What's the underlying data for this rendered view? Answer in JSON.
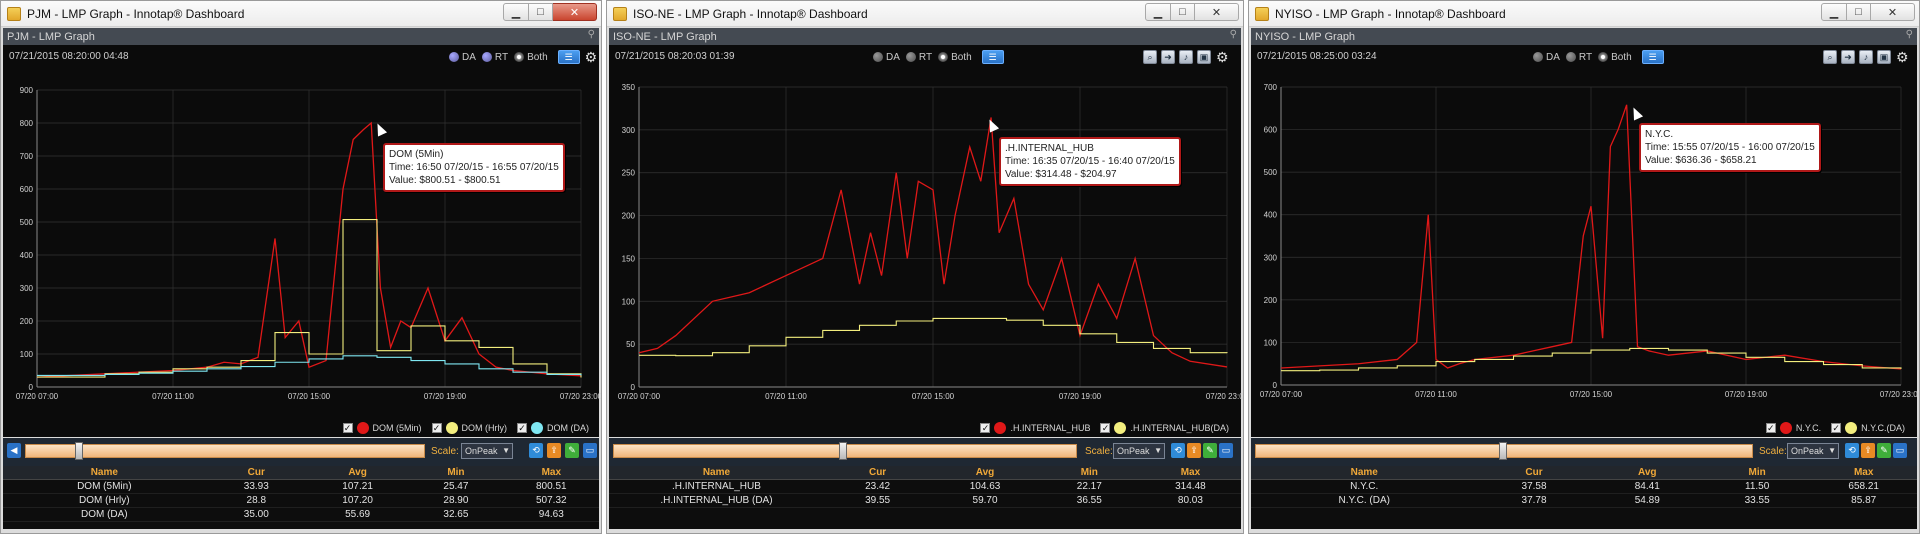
{
  "windows": [
    {
      "title": "PJM - LMP Graph - Innotap® Dashboard",
      "subtitle": "PJM - LMP Graph",
      "timestamp": "07/21/2015 08:20:00  04:48",
      "radio": {
        "da": "DA",
        "rt": "RT",
        "both": "Both",
        "selected": "Both"
      },
      "tooltip": {
        "title": "DOM (5Min)",
        "time": "Time: 16:50 07/20/15 - 16:55 07/20/15",
        "value": "Value: $800.51 - $800.51"
      },
      "scale_label": "Scale:",
      "scale_value": "OnPeak",
      "table": {
        "headers": [
          "Name",
          "Cur",
          "Avg",
          "Min",
          "Max"
        ],
        "rows": [
          [
            "DOM (5Min)",
            "33.93",
            "107.21",
            "25.47",
            "800.51"
          ],
          [
            "DOM (Hrly)",
            "28.8",
            "107.20",
            "28.90",
            "507.32"
          ],
          [
            "DOM (DA)",
            "35.00",
            "55.69",
            "32.65",
            "94.63"
          ]
        ]
      },
      "legend": [
        {
          "label": "DOM (5Min)",
          "color": "#e01818"
        },
        {
          "label": "DOM (Hrly)",
          "color": "#f3ee7e"
        },
        {
          "label": "DOM (DA)",
          "color": "#7fe7f2"
        }
      ]
    },
    {
      "title": "ISO-NE - LMP Graph - Innotap® Dashboard",
      "subtitle": "ISO-NE - LMP Graph",
      "timestamp": "07/21/2015 08:20:03  01:39",
      "radio": {
        "da": "DA",
        "rt": "RT",
        "both": "Both",
        "selected": "Both"
      },
      "tooltip": {
        "title": ".H.INTERNAL_HUB",
        "time": "Time: 16:35 07/20/15 - 16:40 07/20/15",
        "value": "Value: $314.48 - $204.97"
      },
      "scale_label": "Scale:",
      "scale_value": "OnPeak",
      "table": {
        "headers": [
          "Name",
          "Cur",
          "Avg",
          "Min",
          "Max"
        ],
        "rows": [
          [
            ".H.INTERNAL_HUB",
            "23.42",
            "104.63",
            "22.17",
            "314.48"
          ],
          [
            ".H.INTERNAL_HUB (DA)",
            "39.55",
            "59.70",
            "36.55",
            "80.03"
          ]
        ]
      },
      "legend": [
        {
          "label": ".H.INTERNAL_HUB",
          "color": "#e01818"
        },
        {
          "label": ".H.INTERNAL_HUB(DA)",
          "color": "#f3ee7e"
        }
      ]
    },
    {
      "title": "NYISO - LMP Graph - Innotap® Dashboard",
      "subtitle": "NYISO - LMP Graph",
      "timestamp": "07/21/2015 08:25:00  03:24",
      "radio": {
        "da": "DA",
        "rt": "RT",
        "both": "Both",
        "selected": "Both"
      },
      "tooltip": {
        "title": "N.Y.C.",
        "time": "Time: 15:55 07/20/15 - 16:00 07/20/15",
        "value": "Value: $636.36 - $658.21"
      },
      "scale_label": "Scale:",
      "scale_value": "OnPeak",
      "table": {
        "headers": [
          "Name",
          "Cur",
          "Avg",
          "Min",
          "Max"
        ],
        "rows": [
          [
            "N.Y.C.",
            "37.58",
            "84.41",
            "11.50",
            "658.21"
          ],
          [
            "N.Y.C. (DA)",
            "37.78",
            "54.89",
            "33.55",
            "85.87"
          ]
        ]
      },
      "legend": [
        {
          "label": "N.Y.C.",
          "color": "#e01818"
        },
        {
          "label": "N.Y.C.(DA)",
          "color": "#f3ee7e"
        }
      ]
    }
  ],
  "chart_data": [
    {
      "type": "line",
      "x_ticks": [
        "07/20 07:00",
        "07/20 11:00",
        "07/20 15:00",
        "07/20 19:00",
        "07/20 23:00"
      ],
      "x_range_hours": [
        7,
        23
      ],
      "ylim": [
        0,
        900
      ],
      "y_ticks": [
        0,
        100,
        200,
        300,
        400,
        500,
        600,
        700,
        800,
        900
      ],
      "series": [
        {
          "name": "DOM (5Min)",
          "color": "#e01818",
          "x": [
            7,
            8,
            9,
            10,
            11,
            12,
            12.5,
            13,
            13.5,
            14,
            14.3,
            14.7,
            15,
            15.5,
            16,
            16.3,
            16.6,
            16.83,
            17.1,
            17.4,
            17.7,
            18,
            18.5,
            19,
            19.5,
            20,
            20.5,
            21,
            22,
            23
          ],
          "values": [
            30,
            35,
            40,
            45,
            50,
            60,
            75,
            70,
            90,
            450,
            150,
            200,
            60,
            80,
            600,
            750,
            780,
            800,
            300,
            120,
            200,
            180,
            300,
            140,
            210,
            100,
            60,
            50,
            40,
            33.93
          ]
        },
        {
          "name": "DOM (Hrly)",
          "color": "#f3ee7e",
          "x": [
            7,
            8,
            9,
            10,
            11,
            12,
            13,
            14,
            15,
            16,
            17,
            18,
            19,
            20,
            21,
            22,
            23
          ],
          "values": [
            30,
            30,
            40,
            45,
            55,
            60,
            80,
            165,
            100,
            507.32,
            110,
            185,
            140,
            120,
            70,
            40,
            28.8
          ]
        },
        {
          "name": "DOM (DA)",
          "color": "#7fe7f2",
          "x": [
            7,
            8,
            9,
            10,
            11,
            12,
            13,
            14,
            15,
            16,
            17,
            18,
            19,
            20,
            21,
            22,
            23
          ],
          "values": [
            35,
            35,
            38,
            42,
            48,
            55,
            62,
            75,
            85,
            94.63,
            90,
            80,
            70,
            55,
            45,
            38,
            35
          ]
        }
      ]
    },
    {
      "type": "line",
      "x_ticks": [
        "07/20 07:00",
        "07/20 11:00",
        "07/20 15:00",
        "07/20 19:00",
        "07/20 23:00"
      ],
      "x_range_hours": [
        7,
        23
      ],
      "ylim": [
        0,
        350
      ],
      "y_ticks": [
        0,
        50,
        100,
        150,
        200,
        250,
        300,
        350
      ],
      "series": [
        {
          "name": ".H.INTERNAL_HUB",
          "color": "#e01818",
          "x": [
            7,
            7.5,
            8,
            9,
            10,
            11,
            12,
            12.5,
            13,
            13.3,
            13.6,
            14,
            14.3,
            14.6,
            15,
            15.3,
            15.6,
            16,
            16.3,
            16.58,
            16.8,
            17.2,
            17.6,
            18,
            18.5,
            19,
            19.5,
            20,
            20.5,
            21,
            21.5,
            22,
            23
          ],
          "values": [
            40,
            45,
            60,
            100,
            110,
            130,
            150,
            230,
            120,
            180,
            130,
            250,
            150,
            240,
            230,
            120,
            200,
            280,
            240,
            314.48,
            180,
            220,
            120,
            90,
            150,
            60,
            120,
            80,
            150,
            60,
            40,
            30,
            23.42
          ]
        },
        {
          "name": ".H.INTERNAL_HUB(DA)",
          "color": "#f3ee7e",
          "x": [
            7,
            8,
            9,
            10,
            11,
            12,
            13,
            14,
            15,
            16,
            17,
            18,
            19,
            20,
            21,
            22,
            23
          ],
          "values": [
            37,
            36.55,
            40,
            48,
            58,
            66,
            72,
            77,
            80.03,
            80,
            78,
            72,
            62,
            52,
            45,
            40,
            39.55
          ]
        }
      ]
    },
    {
      "type": "line",
      "x_ticks": [
        "07/20 07:00",
        "07/20 11:00",
        "07/20 15:00",
        "07/20 19:00",
        "07/20 23:00"
      ],
      "x_range_hours": [
        7,
        23
      ],
      "ylim": [
        0,
        700
      ],
      "y_ticks": [
        0,
        100,
        200,
        300,
        400,
        500,
        600,
        700
      ],
      "series": [
        {
          "name": "N.Y.C.",
          "color": "#e01818",
          "x": [
            7,
            8,
            9,
            10,
            10.5,
            10.8,
            11,
            11.3,
            11.6,
            12,
            13,
            14,
            14.5,
            14.8,
            15,
            15.3,
            15.5,
            15.7,
            15.92,
            16.2,
            16.5,
            17,
            18,
            19,
            20,
            21,
            22,
            23
          ],
          "values": [
            40,
            45,
            50,
            60,
            100,
            400,
            60,
            40,
            50,
            60,
            70,
            90,
            100,
            350,
            420,
            110,
            560,
            600,
            658.21,
            90,
            80,
            70,
            80,
            60,
            70,
            55,
            45,
            37.58
          ]
        },
        {
          "name": "N.Y.C.(DA)",
          "color": "#f3ee7e",
          "x": [
            7,
            8,
            9,
            10,
            11,
            12,
            13,
            14,
            15,
            16,
            17,
            18,
            19,
            20,
            21,
            22,
            23
          ],
          "values": [
            33.55,
            35,
            40,
            45,
            55,
            60,
            68,
            75,
            82,
            85.87,
            82,
            75,
            65,
            55,
            48,
            40,
            37.78
          ]
        }
      ]
    }
  ]
}
